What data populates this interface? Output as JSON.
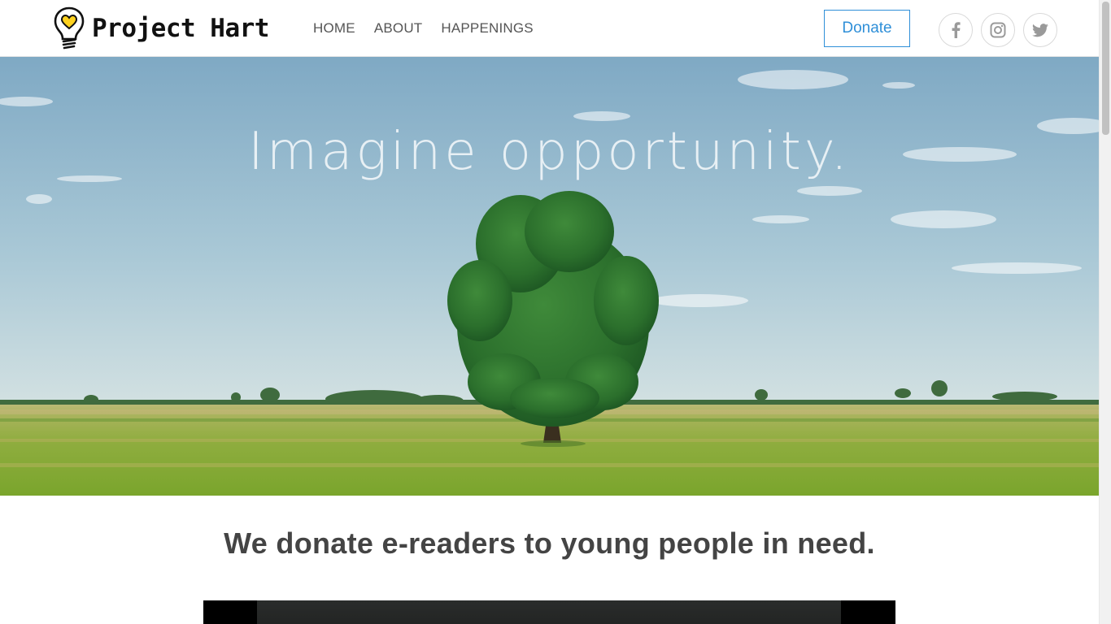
{
  "header": {
    "brand_name": "Project Hart",
    "nav": [
      {
        "label": "HOME"
      },
      {
        "label": "ABOUT"
      },
      {
        "label": "HAPPENINGS"
      }
    ],
    "donate_label": "Donate",
    "social": [
      {
        "icon": "facebook-icon"
      },
      {
        "icon": "instagram-icon"
      },
      {
        "icon": "twitter-icon"
      }
    ]
  },
  "hero": {
    "headline": "Imagine opportunity."
  },
  "mission": {
    "text": "We donate e-readers to young people in need."
  },
  "colors": {
    "accent": "#2f8fd8",
    "logo_heart": "#ffd21f",
    "text": "#444444"
  }
}
